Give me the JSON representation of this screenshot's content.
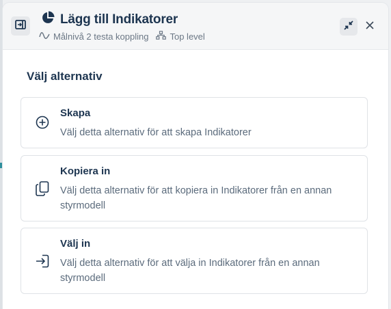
{
  "header": {
    "title": "Lägg till Indikatorer",
    "meta": [
      {
        "icon": "wave-icon",
        "label": "Målnivå 2 testa koppling"
      },
      {
        "icon": "hierarchy-icon",
        "label": "Top level"
      }
    ]
  },
  "main": {
    "section_title": "Välj alternativ",
    "options": [
      {
        "icon": "plus-circle-icon",
        "title": "Skapa",
        "description": "Välj detta alternativ för att skapa Indikatorer"
      },
      {
        "icon": "copy-icon",
        "title": "Kopiera in",
        "description": "Välj detta alternativ för att kopiera in Indikatorer från en annan styrmodell"
      },
      {
        "icon": "sign-in-icon",
        "title": "Välj in",
        "description": "Välj detta alternativ för att välja in Indikatorer från en annan styrmodell"
      }
    ]
  },
  "colors": {
    "title": "#1d3550",
    "muted": "#6b7785",
    "border": "#dfe2e6",
    "accent": "#2f8f9d"
  }
}
